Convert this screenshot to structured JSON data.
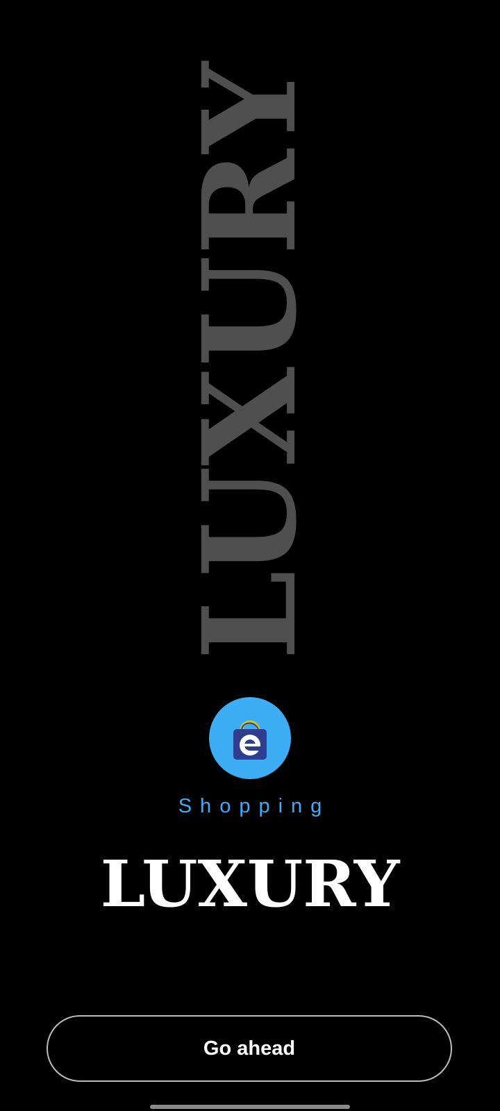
{
  "watermark": {
    "text": "LUXURY"
  },
  "logo": {
    "icon": "shopping-bag-e-icon",
    "circle_color": "#3daef5"
  },
  "brand": {
    "subtitle": "Shopping",
    "subtitle_color": "#45a8f2",
    "title": "LUXURY"
  },
  "actions": {
    "go_label": "Go ahead"
  }
}
